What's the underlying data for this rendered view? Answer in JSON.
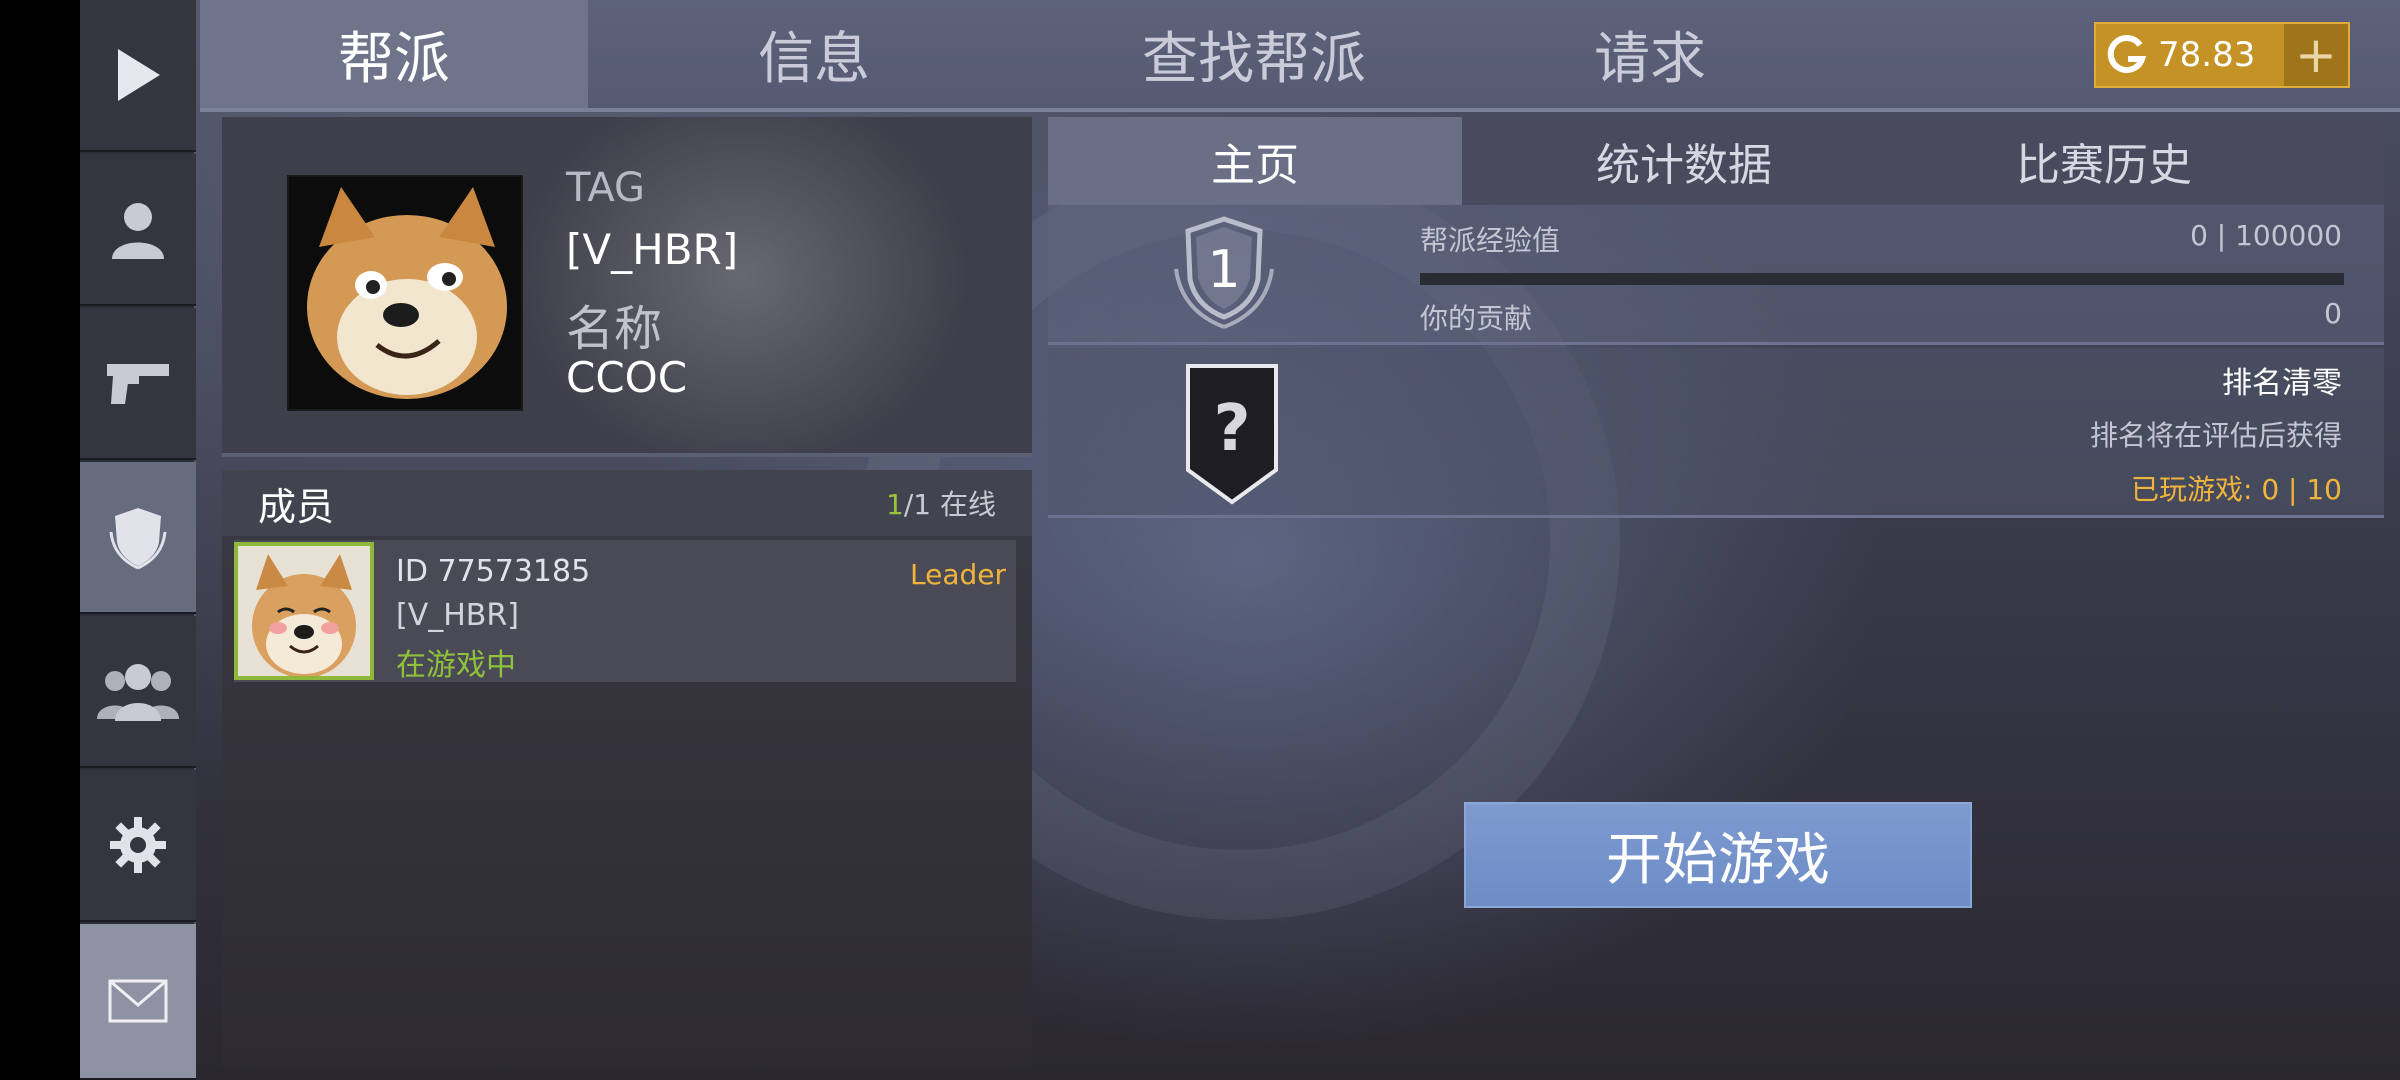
{
  "tabs": {
    "clan": "帮派",
    "info": "信息",
    "find_clan": "查找帮派",
    "requests": "请求"
  },
  "currency": {
    "icon": "g-coin-icon",
    "value": "78.83",
    "plus": "+"
  },
  "sidebar": {
    "items": [
      {
        "icon": "play-icon"
      },
      {
        "icon": "profile-icon"
      },
      {
        "icon": "pistol-icon"
      },
      {
        "icon": "clan-shield-icon"
      },
      {
        "icon": "friends-icon"
      },
      {
        "icon": "settings-gear-icon"
      },
      {
        "icon": "mail-icon"
      }
    ]
  },
  "profile": {
    "tag_label": "TAG",
    "tag_value": "[V_HBR]",
    "name_label": "名称",
    "name_value": "CCOC"
  },
  "members": {
    "title": "成员",
    "online_count": "1",
    "online_total": "/1 在线",
    "list": [
      {
        "id": "ID 77573185",
        "tag": "[V_HBR]",
        "status": "在游戏中",
        "role": "Leader"
      }
    ]
  },
  "subtabs": {
    "home": "主页",
    "stats": "统计数据",
    "match_history": "比赛历史"
  },
  "level": {
    "number": "1"
  },
  "experience": {
    "label": "帮派经验值",
    "value": "0 | 100000",
    "progress": 0,
    "contribution_label": "你的贡献",
    "contribution_value": "0"
  },
  "rank": {
    "badge": "?",
    "title": "排名清零",
    "subtitle": "排名将在评估后获得",
    "games_played": "已玩游戏:  0 | 10"
  },
  "actions": {
    "start_game": "开始游戏"
  },
  "colors": {
    "accent_gold": "#f0b43c",
    "online_green": "#8fc13b",
    "start_button": "#7593cb"
  }
}
